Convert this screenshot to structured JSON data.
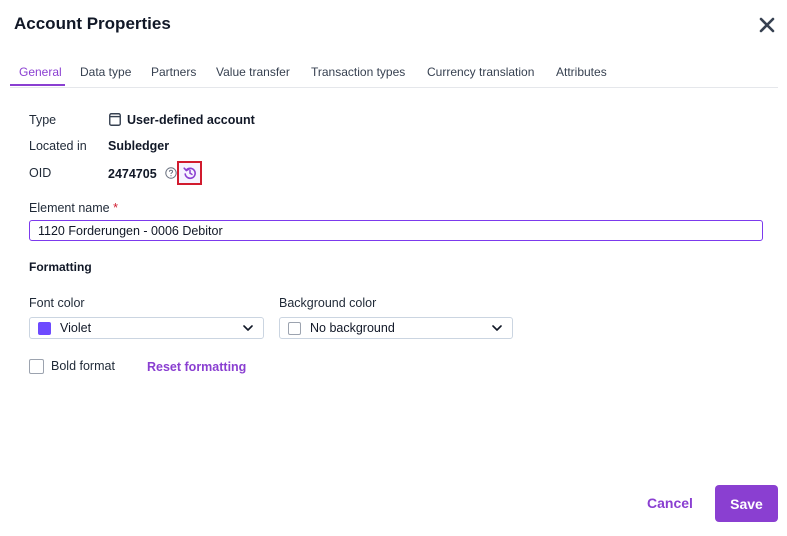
{
  "dialog": {
    "title": "Account Properties"
  },
  "tabs": [
    {
      "label": "General",
      "active": true
    },
    {
      "label": "Data type"
    },
    {
      "label": "Partners"
    },
    {
      "label": "Value transfer"
    },
    {
      "label": "Transaction types"
    },
    {
      "label": "Currency translation"
    },
    {
      "label": "Attributes"
    }
  ],
  "properties": {
    "type_label": "Type",
    "type_value": "User-defined account",
    "located_label": "Located in",
    "located_value": "Subledger",
    "oid_label": "OID",
    "oid_value": "2474705"
  },
  "element_name": {
    "label": "Element name",
    "required_mark": "*",
    "value": "1120 Forderungen - 0006 Debitor"
  },
  "formatting": {
    "heading": "Formatting",
    "font_color_label": "Font color",
    "font_color_value": "Violet",
    "font_color_swatch": "#6d4aff",
    "background_color_label": "Background color",
    "background_color_value": "No background",
    "bold_label": "Bold format",
    "bold_checked": false,
    "reset_label": "Reset formatting"
  },
  "footer": {
    "cancel_label": "Cancel",
    "save_label": "Save"
  },
  "colors": {
    "accent": "#8a3fd1",
    "highlight_border": "#d11b2e"
  },
  "icons": {
    "close": "close-icon",
    "type": "document-icon",
    "help": "help-circle-icon",
    "history": "history-icon",
    "dropdown": "chevron-down-icon"
  }
}
